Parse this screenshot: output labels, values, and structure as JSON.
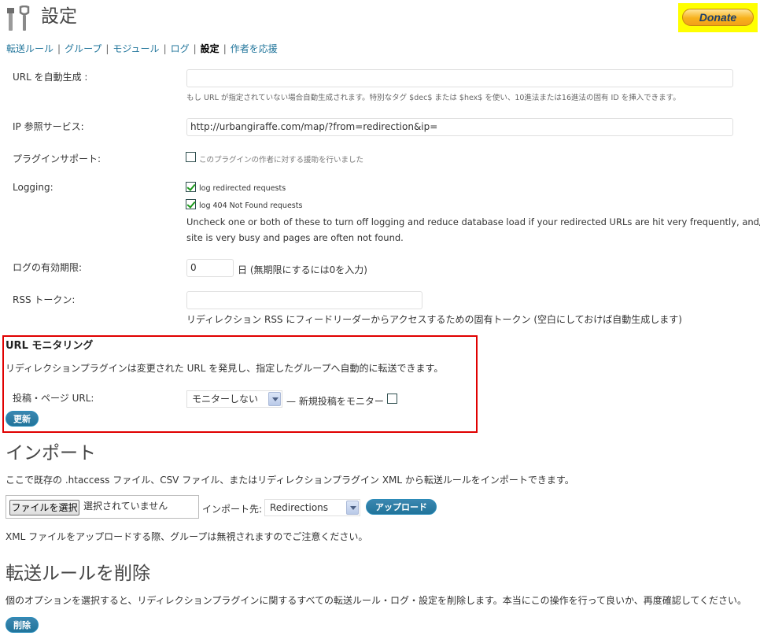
{
  "page": {
    "title": "設定"
  },
  "donate": {
    "label": "Donate"
  },
  "subnav": {
    "items": [
      "転送ルール",
      "グループ",
      "モジュール",
      "ログ",
      "設定",
      "作者を応援"
    ],
    "separator": "|"
  },
  "settings": {
    "auto_url": {
      "label": "URL を自動生成 :",
      "value": "",
      "desc": "もし URL が指定されていない場合自動生成されます。特別なタグ $dec$ または $hex$ を使い、10進法または16進法の固有 ID を挿入できます。"
    },
    "ip_lookup": {
      "label": "IP 参照サービス:",
      "value": "http://urbangiraffe.com/map/?from=redirection&ip="
    },
    "plugin_support": {
      "label": "プラグインサポート:",
      "checkbox_label": "このプラグインの作者に対する援助を行いました",
      "checked": false
    },
    "logging": {
      "label": "Logging:",
      "options": [
        {
          "label": "log redirected requests",
          "checked": true
        },
        {
          "label": "log 404 Not Found requests",
          "checked": true
        }
      ],
      "desc_line1": "Uncheck one or both of these to turn off logging and reduce database load if your redirected URLs are hit very frequently, and/or your",
      "desc_line2": "site is very busy and pages are often not found."
    },
    "expiry": {
      "label": "ログの有効期限:",
      "value": "0",
      "suffix": "日 (無期限にするには0を入力)"
    },
    "rss": {
      "label": "RSS トークン:",
      "value": "",
      "desc": "リディレクション RSS にフィードリーダーからアクセスするための固有トークン (空白にしておけば自動生成します)"
    }
  },
  "monitoring": {
    "heading": "URL モニタリング",
    "desc": "リディレクションプラグインは変更された URL を発見し、指定したグループへ自動的に転送できます。",
    "post_label": "投稿・ページ URL:",
    "select_value": "モニターしない",
    "new_posts_label": "— 新規投稿をモニター",
    "new_posts_checked": false,
    "update_button": "更新"
  },
  "import": {
    "heading": "インポート",
    "desc": "ここで既存の .htaccess ファイル、CSV ファイル、またはリディレクションプラグイン XML から転送ルールをインポートできます。",
    "file_button": "ファイルを選択",
    "file_status": "選択されていません",
    "target_label": "インポート先:",
    "target_value": "Redirections",
    "upload_button": "アップロード",
    "note": "XML ファイルをアップロードする際、グループは無視されますのでご注意ください。"
  },
  "delete": {
    "heading": "転送ルールを削除",
    "desc": "個のオプションを選択すると、リディレクションプラグインに関するすべての転送ルール・ログ・設定を削除します。本当にこの操作を行って良いか、再度確認してください。",
    "button": "削除"
  },
  "colors": {
    "link": "#21759b",
    "button": "#21759b",
    "highlight_border": "#e00000",
    "donate_bg": "#ffff00",
    "checkmark": "#1a9a1a"
  },
  "icons": {
    "title": "tools-icon",
    "dropdown": "chevron-down-icon"
  }
}
